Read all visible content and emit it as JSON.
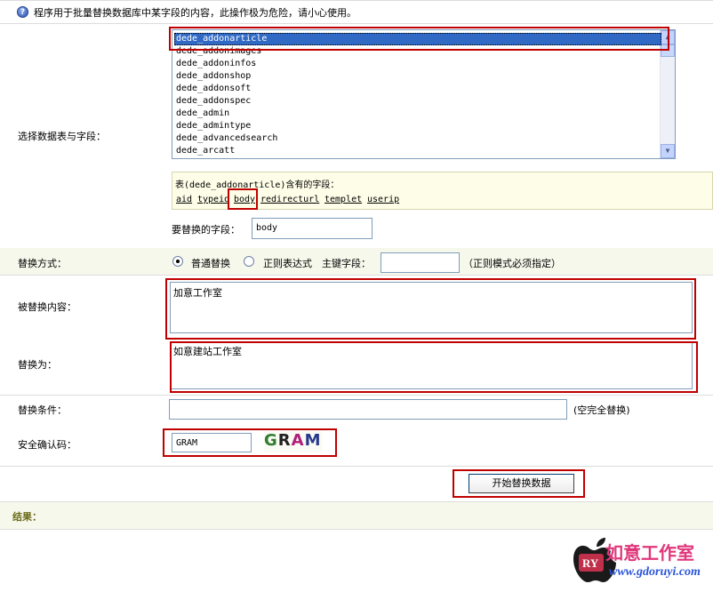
{
  "header": {
    "notice": "程序用于批量替换数据库中某字段的内容，此操作极为危险，请小心使用。",
    "icon": "info-icon"
  },
  "table_select": {
    "label": "选择数据表与字段：",
    "tables": [
      "dede_addonarticle",
      "dede_addonimages",
      "dede_addoninfos",
      "dede_addonshop",
      "dede_addonsoft",
      "dede_addonspec",
      "dede_admin",
      "dede_admintype",
      "dede_advancedsearch",
      "dede_arcatt"
    ],
    "selected": "dede_addonarticle"
  },
  "fields_panel": {
    "caption": "表(dede_addonarticle)含有的字段：",
    "fields": [
      "aid",
      "typeid",
      "body",
      "redirecturl",
      "templet",
      "userip"
    ]
  },
  "replace_field": {
    "label": "要替换的字段：",
    "value": "body"
  },
  "mode": {
    "label": "替换方式：",
    "option_normal": "普通替换",
    "option_regex": "正则表达式",
    "pk_label": "主键字段：",
    "pk_value": "",
    "note": "（正则模式必须指定）",
    "selected": "普通替换"
  },
  "find": {
    "label": "被替换内容：",
    "value": "加意工作室"
  },
  "replace_to": {
    "label": "替换为：",
    "value": "如意建站工作室"
  },
  "condition": {
    "label": "替换条件：",
    "value": "",
    "note": "(空完全替换)"
  },
  "captcha": {
    "label": "安全确认码：",
    "value": "GRAM",
    "image_text": "GRAM"
  },
  "submit": {
    "label": "开始替换数据"
  },
  "result": {
    "label": "结果："
  },
  "watermark": {
    "url": "www.gdoruyi.com"
  },
  "colors": {
    "highlight": "#c00000",
    "selection": "#316ac5",
    "result_bg": "#f7f8ec",
    "result_label": "#6b6b1a"
  }
}
